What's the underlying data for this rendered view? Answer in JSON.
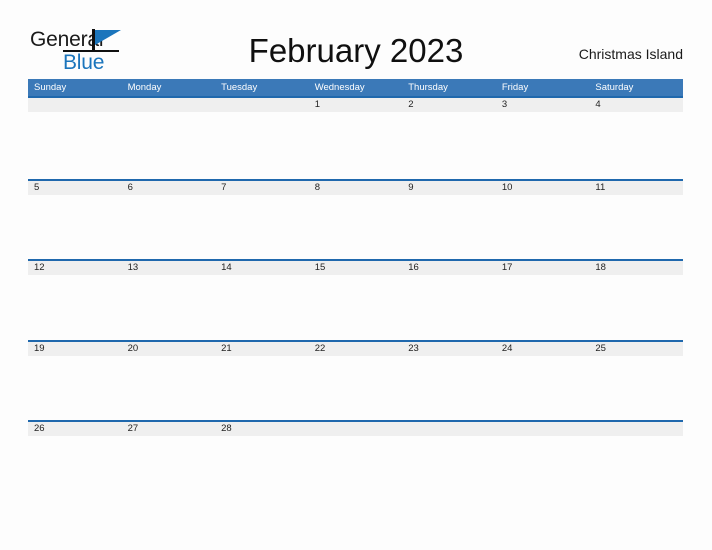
{
  "brand": {
    "name_part1": "General",
    "name_part2": "Blue",
    "flag_icon": "flag-triangle-icon",
    "accent_color": "#1b75bc"
  },
  "header": {
    "title": "February 2023",
    "location": "Christmas Island"
  },
  "calendar": {
    "month": "February",
    "year": "2023",
    "header_bg_color": "#3b79b8",
    "row_separator_color": "#1f68ad",
    "band_bg_color": "#efefef",
    "weekday_headers": [
      "Sunday",
      "Monday",
      "Tuesday",
      "Wednesday",
      "Thursday",
      "Friday",
      "Saturday"
    ],
    "weeks": [
      {
        "days": [
          "",
          "",
          "",
          "1",
          "2",
          "3",
          "4"
        ]
      },
      {
        "days": [
          "5",
          "6",
          "7",
          "8",
          "9",
          "10",
          "11"
        ]
      },
      {
        "days": [
          "12",
          "13",
          "14",
          "15",
          "16",
          "17",
          "18"
        ]
      },
      {
        "days": [
          "19",
          "20",
          "21",
          "22",
          "23",
          "24",
          "25"
        ]
      },
      {
        "days": [
          "26",
          "27",
          "28",
          "",
          "",
          "",
          ""
        ]
      }
    ]
  }
}
